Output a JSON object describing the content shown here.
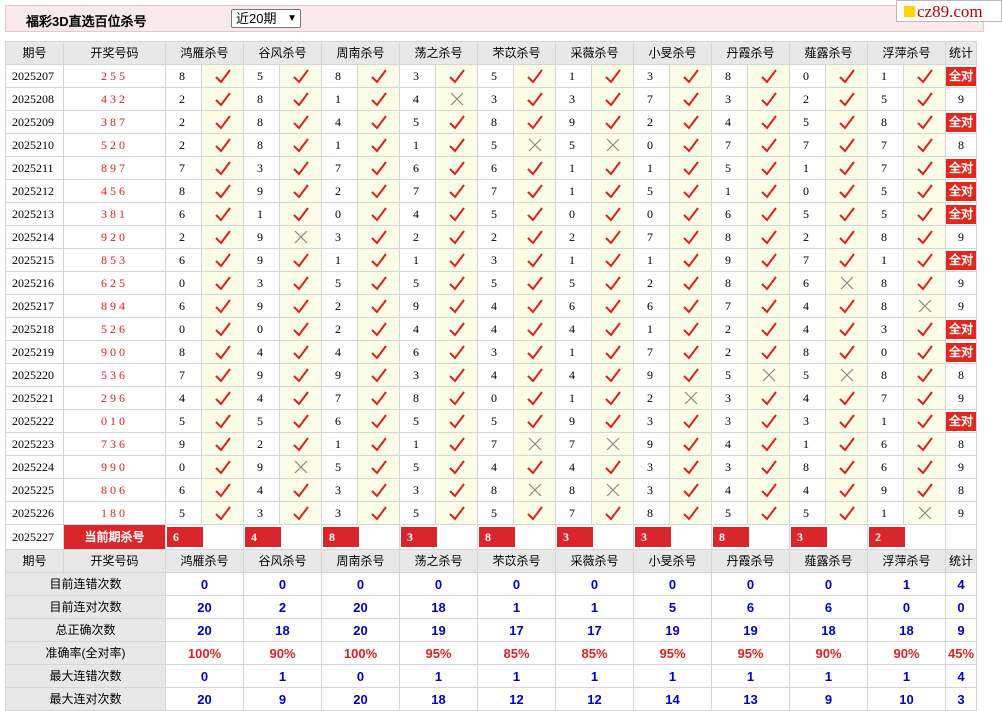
{
  "header": {
    "title": "福彩3D直选百位杀号",
    "select_value": "近20期",
    "select_arrow": "▼"
  },
  "logo": {
    "text": "cz89.com"
  },
  "columns": {
    "period": "期号",
    "number": "开奖号码",
    "experts": [
      "鸿雁杀号",
      "谷风杀号",
      "周南杀号",
      "荡之杀号",
      "芣苡杀号",
      "采薇杀号",
      "小旻杀号",
      "丹霞杀号",
      "薤露杀号",
      "浮萍杀号"
    ],
    "stat": "统计"
  },
  "allright_label": "全对",
  "rows": [
    {
      "period": "2025207",
      "number": "255",
      "kills": [
        8,
        5,
        8,
        3,
        5,
        1,
        3,
        8,
        0,
        1
      ],
      "ok": [
        1,
        1,
        1,
        1,
        1,
        1,
        1,
        1,
        1,
        1
      ],
      "stat": "全对"
    },
    {
      "period": "2025208",
      "number": "432",
      "kills": [
        2,
        8,
        1,
        4,
        3,
        3,
        7,
        3,
        2,
        5
      ],
      "ok": [
        1,
        1,
        1,
        0,
        1,
        1,
        1,
        1,
        1,
        1
      ],
      "stat": "9"
    },
    {
      "period": "2025209",
      "number": "387",
      "kills": [
        2,
        8,
        4,
        5,
        8,
        9,
        2,
        4,
        5,
        8
      ],
      "ok": [
        1,
        1,
        1,
        1,
        1,
        1,
        1,
        1,
        1,
        1
      ],
      "stat": "全对"
    },
    {
      "period": "2025210",
      "number": "520",
      "kills": [
        2,
        8,
        1,
        1,
        5,
        5,
        0,
        7,
        7,
        7
      ],
      "ok": [
        1,
        1,
        1,
        1,
        0,
        0,
        1,
        1,
        1,
        1
      ],
      "stat": "8"
    },
    {
      "period": "2025211",
      "number": "897",
      "kills": [
        7,
        3,
        7,
        6,
        6,
        1,
        1,
        5,
        1,
        7
      ],
      "ok": [
        1,
        1,
        1,
        1,
        1,
        1,
        1,
        1,
        1,
        1
      ],
      "stat": "全对"
    },
    {
      "period": "2025212",
      "number": "456",
      "kills": [
        8,
        9,
        2,
        7,
        7,
        1,
        5,
        1,
        0,
        5
      ],
      "ok": [
        1,
        1,
        1,
        1,
        1,
        1,
        1,
        1,
        1,
        1
      ],
      "stat": "全对"
    },
    {
      "period": "2025213",
      "number": "381",
      "kills": [
        6,
        1,
        0,
        4,
        5,
        0,
        0,
        6,
        5,
        5
      ],
      "ok": [
        1,
        1,
        1,
        1,
        1,
        1,
        1,
        1,
        1,
        1
      ],
      "stat": "全对"
    },
    {
      "period": "2025214",
      "number": "920",
      "kills": [
        2,
        9,
        3,
        2,
        2,
        2,
        7,
        8,
        2,
        8
      ],
      "ok": [
        1,
        0,
        1,
        1,
        1,
        1,
        1,
        1,
        1,
        1
      ],
      "stat": "9"
    },
    {
      "period": "2025215",
      "number": "853",
      "kills": [
        6,
        9,
        1,
        1,
        3,
        1,
        1,
        9,
        7,
        1
      ],
      "ok": [
        1,
        1,
        1,
        1,
        1,
        1,
        1,
        1,
        1,
        1
      ],
      "stat": "全对"
    },
    {
      "period": "2025216",
      "number": "625",
      "kills": [
        0,
        3,
        5,
        5,
        5,
        5,
        2,
        8,
        6,
        8
      ],
      "ok": [
        1,
        1,
        1,
        1,
        1,
        1,
        1,
        1,
        0,
        1
      ],
      "stat": "9"
    },
    {
      "period": "2025217",
      "number": "894",
      "kills": [
        6,
        9,
        2,
        9,
        4,
        6,
        6,
        7,
        4,
        8
      ],
      "ok": [
        1,
        1,
        1,
        1,
        1,
        1,
        1,
        1,
        1,
        0
      ],
      "stat": "9"
    },
    {
      "period": "2025218",
      "number": "526",
      "kills": [
        0,
        0,
        2,
        4,
        4,
        4,
        1,
        2,
        4,
        3
      ],
      "ok": [
        1,
        1,
        1,
        1,
        1,
        1,
        1,
        1,
        1,
        1
      ],
      "stat": "全对"
    },
    {
      "period": "2025219",
      "number": "900",
      "kills": [
        8,
        4,
        4,
        6,
        3,
        1,
        7,
        2,
        8,
        0
      ],
      "ok": [
        1,
        1,
        1,
        1,
        1,
        1,
        1,
        1,
        1,
        1
      ],
      "stat": "全对"
    },
    {
      "period": "2025220",
      "number": "536",
      "kills": [
        7,
        9,
        9,
        3,
        4,
        4,
        9,
        5,
        5,
        8
      ],
      "ok": [
        1,
        1,
        1,
        1,
        1,
        1,
        1,
        0,
        0,
        1
      ],
      "stat": "8"
    },
    {
      "period": "2025221",
      "number": "296",
      "kills": [
        4,
        4,
        7,
        8,
        0,
        1,
        2,
        3,
        4,
        7
      ],
      "ok": [
        1,
        1,
        1,
        1,
        1,
        1,
        0,
        1,
        1,
        1
      ],
      "stat": "9"
    },
    {
      "period": "2025222",
      "number": "010",
      "kills": [
        5,
        5,
        6,
        5,
        5,
        9,
        3,
        3,
        3,
        1
      ],
      "ok": [
        1,
        1,
        1,
        1,
        1,
        1,
        1,
        1,
        1,
        1
      ],
      "stat": "全对"
    },
    {
      "period": "2025223",
      "number": "736",
      "kills": [
        9,
        2,
        1,
        1,
        7,
        7,
        9,
        4,
        1,
        6
      ],
      "ok": [
        1,
        1,
        1,
        1,
        0,
        0,
        1,
        1,
        1,
        1
      ],
      "stat": "8"
    },
    {
      "period": "2025224",
      "number": "990",
      "kills": [
        0,
        9,
        5,
        5,
        4,
        4,
        3,
        3,
        8,
        6
      ],
      "ok": [
        1,
        0,
        1,
        1,
        1,
        1,
        1,
        1,
        1,
        1
      ],
      "stat": "9"
    },
    {
      "period": "2025225",
      "number": "806",
      "kills": [
        6,
        4,
        3,
        3,
        8,
        8,
        3,
        4,
        4,
        9
      ],
      "ok": [
        1,
        1,
        1,
        1,
        0,
        0,
        1,
        1,
        1,
        1
      ],
      "stat": "8"
    },
    {
      "period": "2025226",
      "number": "180",
      "kills": [
        5,
        3,
        3,
        5,
        5,
        7,
        8,
        5,
        5,
        1
      ],
      "ok": [
        1,
        1,
        1,
        1,
        1,
        1,
        1,
        1,
        1,
        0
      ],
      "stat": "9"
    }
  ],
  "current": {
    "period": "2025227",
    "label": "当前期杀号",
    "kills": [
      6,
      4,
      8,
      3,
      8,
      3,
      3,
      8,
      3,
      2
    ]
  },
  "footer_header": {
    "period": "期号",
    "number": "开奖号码"
  },
  "stats": [
    {
      "label": "目前连错次数",
      "values": [
        "0",
        "0",
        "0",
        "0",
        "0",
        "0",
        "0",
        "0",
        "0",
        "1"
      ],
      "total": "4",
      "color": "blue"
    },
    {
      "label": "目前连对次数",
      "values": [
        "20",
        "2",
        "20",
        "18",
        "1",
        "1",
        "5",
        "6",
        "6",
        "0"
      ],
      "total": "0",
      "color": "blue"
    },
    {
      "label": "总正确次数",
      "values": [
        "20",
        "18",
        "20",
        "19",
        "17",
        "17",
        "19",
        "19",
        "18",
        "18"
      ],
      "total": "9",
      "color": "blue"
    },
    {
      "label": "准确率(全对率)",
      "values": [
        "100%",
        "90%",
        "100%",
        "95%",
        "85%",
        "85%",
        "95%",
        "95%",
        "90%",
        "90%"
      ],
      "total": "45%",
      "color": "red"
    },
    {
      "label": "最大连错次数",
      "values": [
        "0",
        "1",
        "0",
        "1",
        "1",
        "1",
        "1",
        "1",
        "1",
        "1"
      ],
      "total": "4",
      "color": "blue"
    },
    {
      "label": "最大连对次数",
      "values": [
        "20",
        "9",
        "20",
        "18",
        "12",
        "12",
        "14",
        "13",
        "9",
        "10"
      ],
      "total": "3",
      "color": "blue"
    }
  ],
  "colors": {
    "check": "#e02020",
    "cross": "#888888",
    "accent": "#d9262c"
  }
}
